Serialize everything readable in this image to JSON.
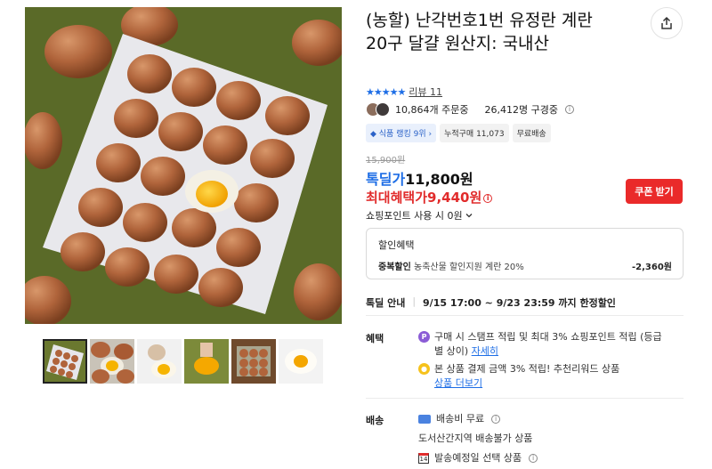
{
  "product": {
    "title": "(농할) 난각번호1번 유정란 계란 20구 달걀 원산지: 국내산",
    "rating_stars": "★★★★★",
    "review_text": "리뷰 11",
    "orders": "10,864개 주문중",
    "subscribers": "26,412명 구경중"
  },
  "badges": {
    "rank": "◆ 식품 랭킹 9위 ›",
    "cumulative": "누적구매 11,073",
    "free_shipping": "무료배송"
  },
  "price": {
    "original": "15,900원",
    "deal_tag": "톡딜가",
    "deal": "11,800원",
    "max_benefit_label": "최대혜택가",
    "max_benefit": "9,440원",
    "coupon_button": "쿠폰 받기",
    "shopping_point": "쇼핑포인트 사용 시 0원"
  },
  "discount": {
    "title": "할인혜택",
    "label": "중복할인",
    "desc": "농축산물 할인지원 계란 20%",
    "amount": "-2,360원"
  },
  "deal_info": {
    "heading": "톡딜 안내",
    "period": "9/15 17:00 ~ 9/23 23:59 까지 한정할인"
  },
  "benefits": {
    "label": "혜택",
    "item1_text": "구매 시 스탬프 적립 및 최대 3% 쇼핑포인트 적립 (등급별 상이)",
    "item1_link": "자세히",
    "item2_text": "본 상품 결제 금액 3% 적립! 추천리워드 상품",
    "item2_link": "상품 더보기"
  },
  "shipping": {
    "label": "배송",
    "fee": "배송비 무료",
    "restriction": "도서산간지역 배송불가 상품",
    "schedule": "발송예정일 선택 상품",
    "calendar_day": "14"
  },
  "icons": {
    "share": "share-icon",
    "info": "info-icon",
    "chevron": "chevron-down-icon"
  },
  "colors": {
    "accent_blue": "#1e6ee6",
    "accent_red": "#ea2a2a"
  }
}
